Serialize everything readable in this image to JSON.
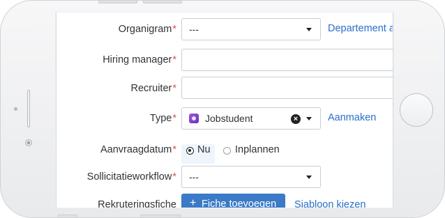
{
  "form": {
    "organigram": {
      "label": "Organigram",
      "value": "---",
      "link": "Departement a"
    },
    "hiring_manager": {
      "label": "Hiring manager",
      "value": ""
    },
    "recruiter": {
      "label": "Recruiter",
      "value": ""
    },
    "type": {
      "label": "Type",
      "value": "Jobstudent",
      "link": "Aanmaken"
    },
    "aanvraagdatum": {
      "label": "Aanvraagdatum",
      "option_now": "Nu",
      "option_plan": "Inplannen",
      "selected": "Nu"
    },
    "sollicitatieworkflow": {
      "label": "Sollicitatieworkflow",
      "value": "---"
    },
    "rekruteringsfiche": {
      "label": "Rekruteringsfiche",
      "button": "Fiche toevoegen",
      "link": "Sjabloon kiezen"
    },
    "required_marker": "*"
  },
  "colors": {
    "accent": "#2a6fc9",
    "required": "#d9534f",
    "button": "#3a7ac6"
  }
}
